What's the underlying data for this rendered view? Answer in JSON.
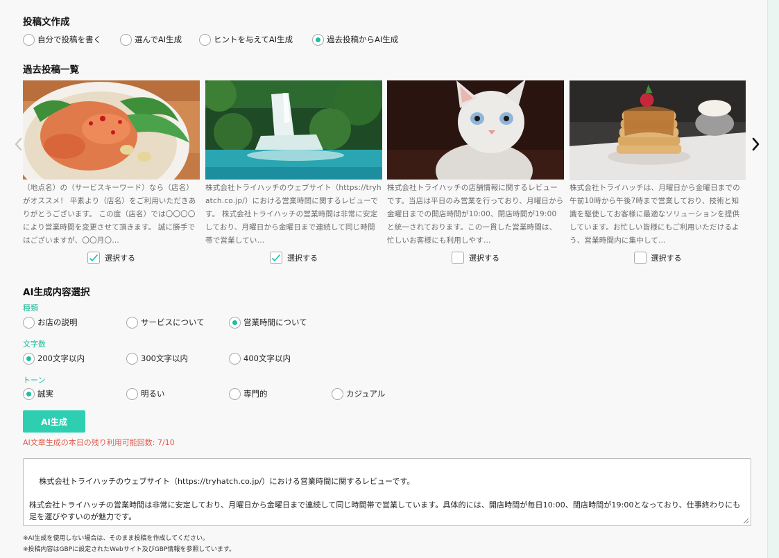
{
  "compose": {
    "title": "投稿文作成",
    "modes": [
      {
        "label": "自分で投稿を書く",
        "selected": false
      },
      {
        "label": "選んでAI生成",
        "selected": false
      },
      {
        "label": "ヒントを与えてAI生成",
        "selected": false
      },
      {
        "label": "過去投稿からAI生成",
        "selected": true
      }
    ]
  },
  "past_posts": {
    "title": "過去投稿一覧",
    "prev_icon": "chevron-left-icon",
    "next_icon": "chevron-right-icon",
    "select_label": "選択する",
    "cards": [
      {
        "image": "noodle-dish-photo",
        "checked": true,
        "text": "（地点名）の（サービスキーワード）なら（店名）がオススメ！ 平素より（店名）をご利用いただきありがとうございます。 この度（店名）では〇〇〇〇により営業時間を変更させて頂きます。 誠に勝手ではございますが、〇〇月〇…"
      },
      {
        "image": "waterfall-photo",
        "checked": true,
        "text": "株式会社トライハッチのウェブサイト（https://tryhatch.co.jp/）における営業時間に関するレビューです。 株式会社トライハッチの営業時間は非常に安定しており、月曜日から金曜日まで連続して同じ時間帯で営業してい…"
      },
      {
        "image": "kitten-photo",
        "checked": false,
        "text": "株式会社トライハッチの店舗情報に関するレビューです。当店は平日のみ営業を行っており、月曜日から金曜日までの開店時間が10:00、閉店時間が19:00と統一されております。この一貫した営業時間は、忙しいお客様にも利用しやす…"
      },
      {
        "image": "pancake-photo",
        "checked": false,
        "text": "株式会社トライハッチは、月曜日から金曜日までの午前10時から午後7時まで営業しており、技術と知識を駆使してお客様に最適なソリューションを提供しています。お忙しい皆様にもご利用いただけるよう、営業時間内に集中して…"
      }
    ]
  },
  "ai_content": {
    "title": "AI生成内容選択",
    "kind": {
      "label": "種類",
      "options": [
        {
          "label": "お店の説明",
          "selected": false
        },
        {
          "label": "サービスについて",
          "selected": false
        },
        {
          "label": "営業時間について",
          "selected": true
        }
      ]
    },
    "length": {
      "label": "文字数",
      "options": [
        {
          "label": "200文字以内",
          "selected": true
        },
        {
          "label": "300文字以内",
          "selected": false
        },
        {
          "label": "400文字以内",
          "selected": false
        }
      ]
    },
    "tone": {
      "label": "トーン",
      "options": [
        {
          "label": "誠実",
          "selected": true
        },
        {
          "label": "明るい",
          "selected": false
        },
        {
          "label": "専門的",
          "selected": false
        },
        {
          "label": "カジュアル",
          "selected": false
        }
      ]
    }
  },
  "generate": {
    "button_label": "AI生成",
    "remaining_text": "AI文章生成の本日の残り利用可能回数: 7/10"
  },
  "output_text": "株式会社トライハッチのウェブサイト（https://tryhatch.co.jp/）における営業時間に関するレビューです。\n\n株式会社トライハッチの営業時間は非常に安定しており、月曜日から金曜日まで連続して同じ時間帯で営業しています。具体的には、開店時間が毎日10:00、閉店時間が19:00となっており、仕事終わりにも足を運びやすいのが魅力です。",
  "notes": [
    "※AI生成を使用しない場合は、そのまま投稿を作成してください。",
    "※投稿内容はGBPに設定されたWebサイト及びGBP情報を参照しています。"
  ],
  "colors": {
    "accent": "#1cbfa2",
    "button": "#2ecfb1",
    "warning": "#e05a4a",
    "sublabel": "#1cb79a"
  }
}
